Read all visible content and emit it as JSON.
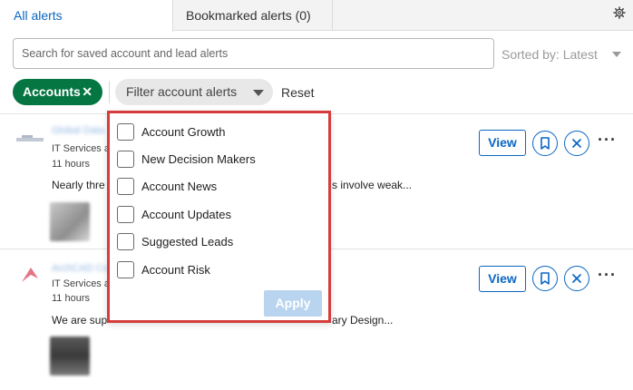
{
  "tabs": {
    "all_alerts": "All alerts",
    "bookmarked": "Bookmarked alerts (0)"
  },
  "search": {
    "placeholder": "Search for saved account and lead alerts"
  },
  "sort": {
    "label": "Sorted by: Latest"
  },
  "filters": {
    "accounts_chip": "Accounts",
    "accounts_chip_close": "✕",
    "filter_button": "Filter account alerts",
    "reset": "Reset"
  },
  "alerts": [
    {
      "company": "Global Data",
      "subtitle": "IT Services a",
      "time": "11 hours",
      "headline_start": "Nearly thre",
      "headline_end": "s involve weak...",
      "view_label": "View",
      "more_label": "···"
    },
    {
      "company": "ArchCAD Co",
      "subtitle": "IT Services a",
      "time": "11 hours",
      "headline_start": "We are sup",
      "headline_end": "ary Design...",
      "view_label": "View",
      "more_label": "···"
    }
  ],
  "dropdown": {
    "options": [
      {
        "label": "Account Growth",
        "checked": false
      },
      {
        "label": "New Decision Makers",
        "checked": false
      },
      {
        "label": "Account News",
        "checked": false
      },
      {
        "label": "Account Updates",
        "checked": false
      },
      {
        "label": "Suggested Leads",
        "checked": false
      },
      {
        "label": "Account Risk",
        "checked": false
      }
    ],
    "apply_label": "Apply"
  },
  "colors": {
    "accent": "#0a66c2",
    "chip_green": "#057642",
    "highlight_border": "#d63c3c"
  },
  "icons": [
    "settings-gear-icon",
    "close-icon",
    "chevron-down-icon",
    "bookmark-icon",
    "dismiss-icon",
    "more-icon"
  ]
}
